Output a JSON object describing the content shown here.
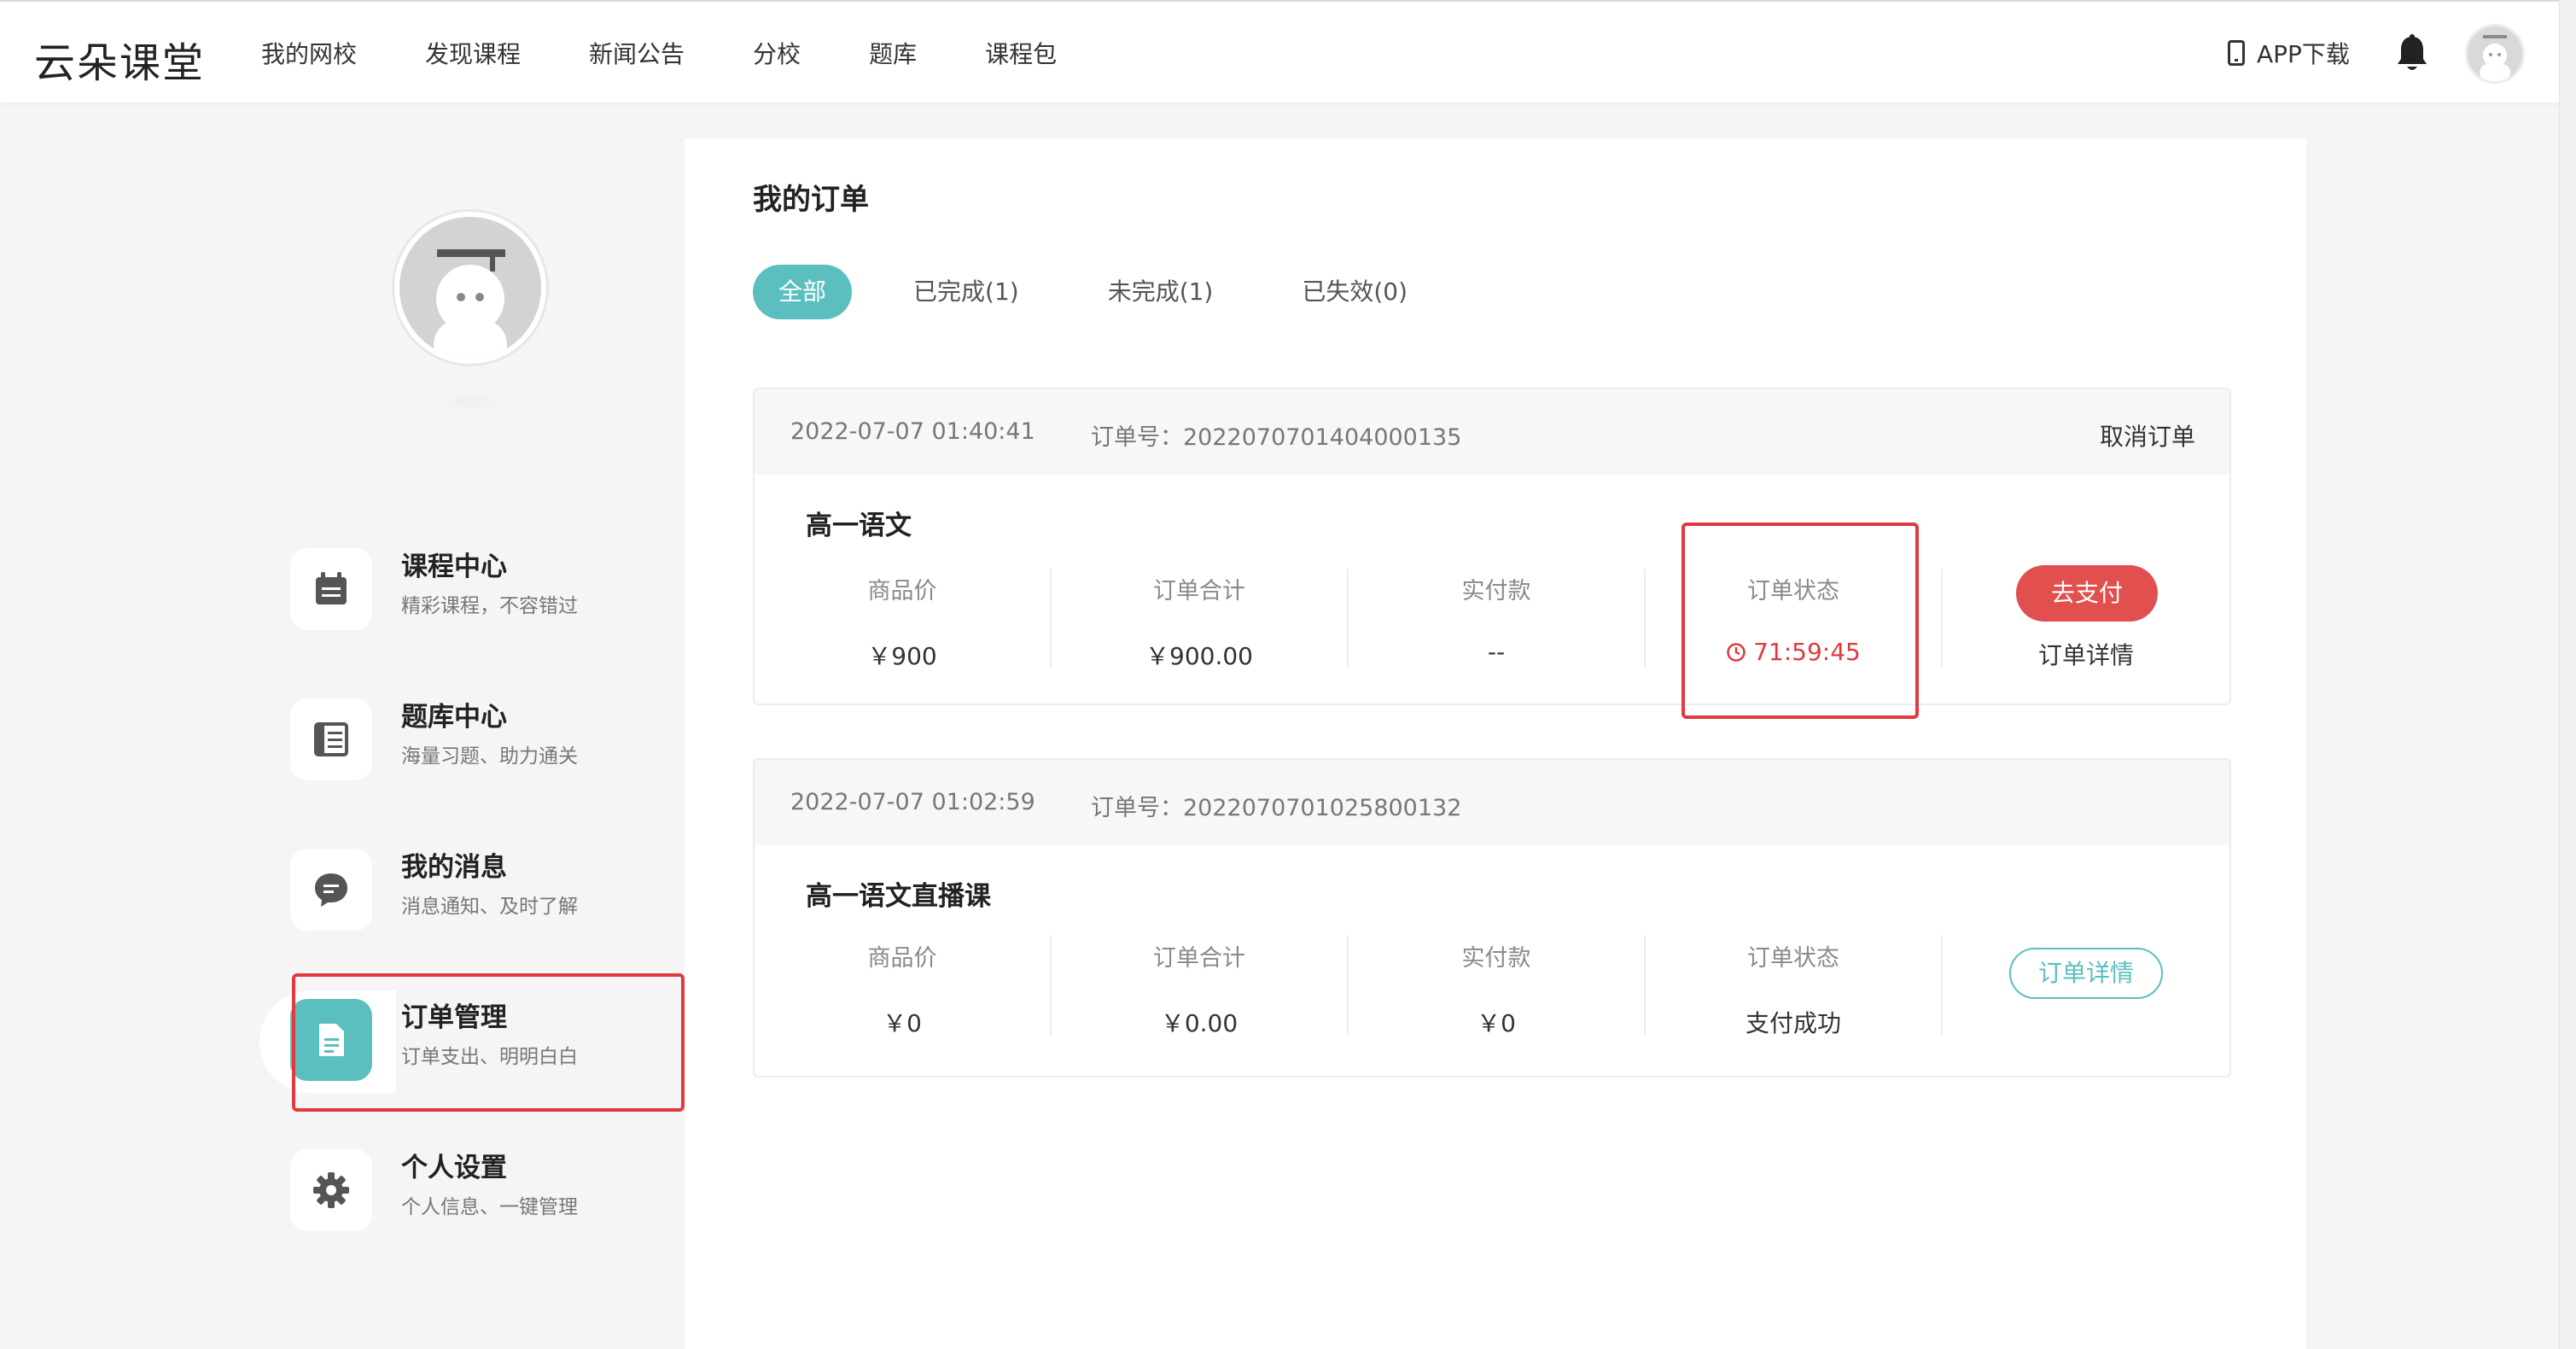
{
  "header": {
    "logo": "云朵课堂",
    "nav": [
      "我的网校",
      "发现课程",
      "新闻公告",
      "分校",
      "题库",
      "课程包"
    ],
    "app_download": "APP下载",
    "icons": {
      "phone": "phone-icon",
      "bell": "bell-icon",
      "avatar": "avatar"
    }
  },
  "sidebar": {
    "profile_name": "‧‧‧‧‧‧",
    "items": [
      {
        "title": "课程中心",
        "subtitle": "精彩课程，不容错过",
        "icon": "calendar-icon"
      },
      {
        "title": "题库中心",
        "subtitle": "海量习题、助力通关",
        "icon": "list-icon"
      },
      {
        "title": "我的消息",
        "subtitle": "消息通知、及时了解",
        "icon": "message-icon"
      },
      {
        "title": "订单管理",
        "subtitle": "订单支出、明明白白",
        "icon": "document-icon",
        "active": true
      },
      {
        "title": "个人设置",
        "subtitle": "个人信息、一键管理",
        "icon": "gear-icon"
      }
    ]
  },
  "main": {
    "title": "我的订单",
    "tabs": [
      {
        "label": "全部",
        "active": true
      },
      {
        "label": "已完成(1)"
      },
      {
        "label": "未完成(1)"
      },
      {
        "label": "已失效(0)"
      }
    ],
    "orders": [
      {
        "date": "2022-07-07 01:40:41",
        "order_no": "订单号：2022070701404000135",
        "cancel": "取消订单",
        "course": "高一语文",
        "columns": [
          {
            "label": "商品价",
            "value": "￥900"
          },
          {
            "label": "订单合计",
            "value": "￥900.00"
          },
          {
            "label": "实付款",
            "value": "--"
          },
          {
            "label": "订单状态",
            "value": "71:59:45"
          }
        ],
        "pay_button": "去支付",
        "detail": "订单详情"
      },
      {
        "date": "2022-07-07 01:02:59",
        "order_no": "订单号：2022070701025800132",
        "course": "高一语文直播课",
        "columns": [
          {
            "label": "商品价",
            "value": "￥0"
          },
          {
            "label": "订单合计",
            "value": "￥0.00"
          },
          {
            "label": "实付款",
            "value": "￥0"
          },
          {
            "label": "订单状态",
            "value": "支付成功"
          }
        ],
        "detail": "订单详情"
      }
    ]
  },
  "colors": {
    "accent": "#5bbfbf",
    "pay_red": "#e24f4f",
    "highlight_red": "#e0393e"
  }
}
